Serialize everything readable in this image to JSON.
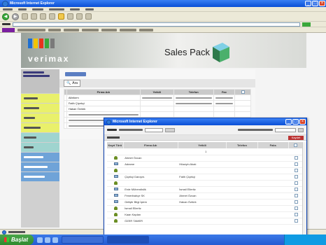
{
  "ie": {
    "title_fragment": "Microsoft Internet Explorer",
    "logo_text": "Yahoo!"
  },
  "page": {
    "brand": "verimax",
    "product_title": "Sales Pack",
    "search_button": "Ara",
    "table_headers": [
      "",
      "Firma Adı",
      "Yetkili",
      "Telefon",
      "Fax",
      ""
    ],
    "table_rows": [
      [
        "Alfaform",
        "",
        "",
        "",
        ""
      ],
      [
        "Fatih Çiçekçi",
        "",
        "",
        "",
        ""
      ],
      [
        "Hakan Öztürk",
        "",
        "",
        "",
        ""
      ]
    ]
  },
  "popup": {
    "title_fragment": "Microsoft Internet Explorer",
    "save_button": "Kaydet",
    "columns": [
      "Kayıt Türü",
      "Firma Adı",
      "Yetkili",
      "Telefon",
      "Faks",
      ""
    ],
    "pager": "1",
    "rows": [
      {
        "type": "person",
        "firma": "Ahmet Özcan",
        "yetkili": "",
        "tel": "",
        "faks": ""
      },
      {
        "type": "card",
        "firma": "Adrame",
        "yetkili": "Hüseyin Akalı",
        "tel": "",
        "faks": ""
      },
      {
        "type": "person",
        "firma": "",
        "yetkili": "",
        "tel": "",
        "faks": ""
      },
      {
        "type": "card",
        "firma": "Çiçekçi Danışm.",
        "yetkili": "Fatih Çiçekçi",
        "tel": "",
        "faks": ""
      },
      {
        "type": "person",
        "firma": "",
        "yetkili": "",
        "tel": "",
        "faks": ""
      },
      {
        "type": "card",
        "firma": "Erde Mühendislik",
        "yetkili": "İsmail Ellertiz",
        "tel": "",
        "faks": ""
      },
      {
        "type": "card",
        "firma": "Feneribahçe SK",
        "yetkili": "Ahmet Özcan",
        "tel": "",
        "faks": ""
      },
      {
        "type": "card",
        "firma": "Geliştir Bilgi İşlem",
        "yetkili": "Hakan Öztürk",
        "tel": "",
        "faks": ""
      },
      {
        "type": "person",
        "firma": "İsmail Ellertiz",
        "yetkili": "",
        "tel": "",
        "faks": ""
      },
      {
        "type": "person",
        "firma": "Kaan Kaplan",
        "yetkili": "",
        "tel": "",
        "faks": ""
      },
      {
        "type": "person",
        "firma": "ÖZER TAMER",
        "yetkili": "",
        "tel": "",
        "faks": ""
      }
    ]
  },
  "taskbar": {
    "start_label": "Başlat"
  }
}
